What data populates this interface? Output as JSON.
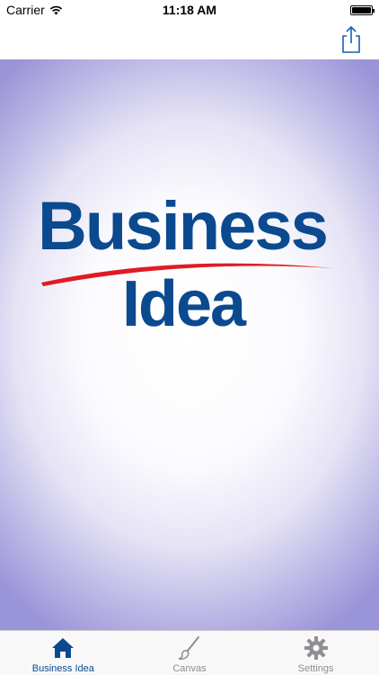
{
  "status_bar": {
    "carrier": "Carrier",
    "time": "11:18 AM"
  },
  "nav_bar": {
    "share_icon": "share-icon"
  },
  "logo": {
    "line1": "Business",
    "line2": "Idea",
    "text_color": "#0b4a8f",
    "swoosh_color": "#e01b24"
  },
  "tab_bar": {
    "tabs": [
      {
        "label": "Business Idea",
        "icon": "home-icon",
        "active": true
      },
      {
        "label": "Canvas",
        "icon": "brush-icon",
        "active": false
      },
      {
        "label": "Settings",
        "icon": "gear-icon",
        "active": false
      }
    ],
    "active_color": "#0b4a8f",
    "inactive_color": "#8e8e93"
  }
}
